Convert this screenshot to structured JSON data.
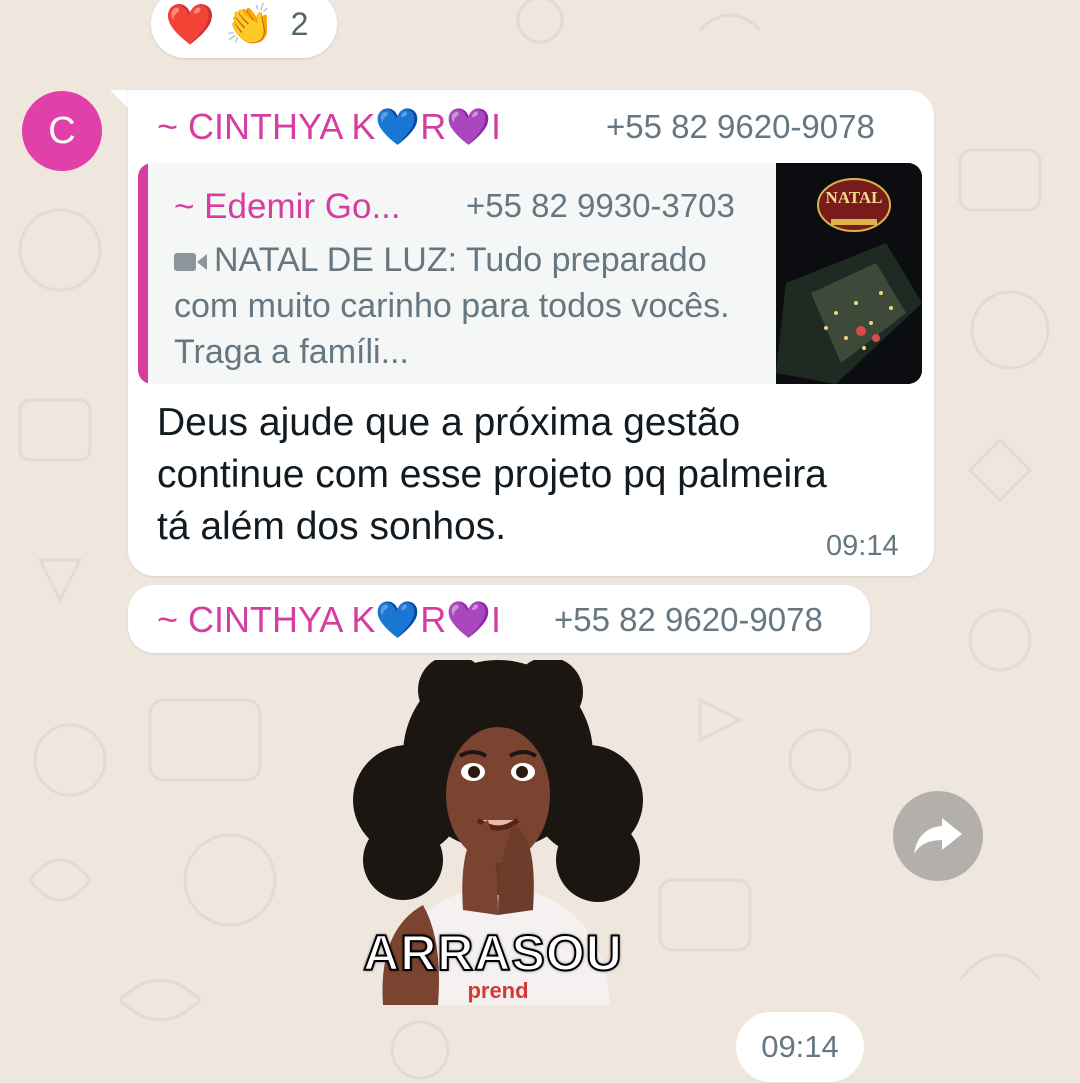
{
  "reactions": {
    "items": [
      {
        "emoji": "❤️",
        "icon": "red-heart-icon"
      },
      {
        "emoji": "👏",
        "icon": "clapping-hands-icon"
      }
    ],
    "count": "2"
  },
  "messages": [
    {
      "avatar_letter": "C",
      "sender_name": "~ CINTHYA K💙R💜I",
      "sender_phone": "+55 82 9620-9078",
      "quoted": {
        "sender_name": "~ Edemir Go...",
        "sender_phone": "+55 82 9930-3703",
        "media_icon": "video-camera-icon",
        "text": "NATAL DE LUZ: Tudo preparado com muito carinho para todos vocês. Traga a famíli...",
        "thumbnail_text": "NATAL"
      },
      "text": "Deus ajude que a próxima gestão continue com esse projeto pq palmeira tá além dos sonhos.",
      "time": "09:14"
    },
    {
      "sender_name": "~ CINTHYA K💙R💜I",
      "sender_phone": "+55 82 9620-9078",
      "sticker_caption": "ARRASOU",
      "time": "09:14"
    }
  ],
  "colors": {
    "wallpaper": "#efe7de",
    "bubble": "#ffffff",
    "sender": "#d63da1",
    "text": "#111b21",
    "meta": "#667781"
  }
}
